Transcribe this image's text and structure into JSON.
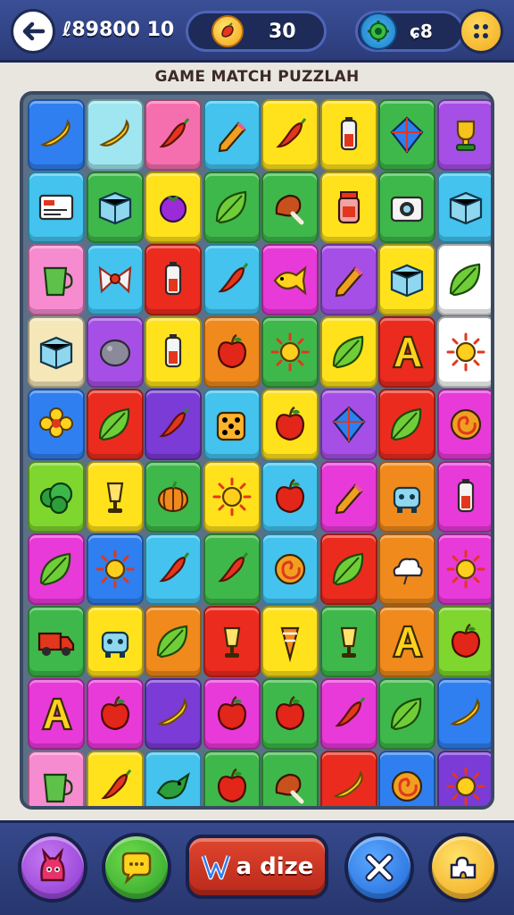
{
  "header": {
    "score_left": "ℓ89800 10",
    "center_count": "30",
    "right_label": "ɕ8",
    "icons": [
      "back-arrow-icon",
      "coin-icon",
      "gear-icon",
      "menu-dots-icon"
    ]
  },
  "title": "GAME MATCH PUZZLAH",
  "board": {
    "columns": 8,
    "rows": 10,
    "tiles": [
      {
        "color": "#2f7ff0",
        "icon": "banana"
      },
      {
        "color": "#9fe6f0",
        "icon": "banana"
      },
      {
        "color": "#f56fae",
        "icon": "chili"
      },
      {
        "color": "#43c3ee",
        "icon": "pencil"
      },
      {
        "color": "#ffe21c",
        "icon": "chili"
      },
      {
        "color": "#ffe21c",
        "icon": "battery"
      },
      {
        "color": "#3eb84a",
        "icon": "kite"
      },
      {
        "color": "#a64fe6",
        "icon": "trophy"
      },
      {
        "color": "#43c3ee",
        "icon": "card"
      },
      {
        "color": "#3eb84a",
        "icon": "box"
      },
      {
        "color": "#ffe21c",
        "icon": "berry"
      },
      {
        "color": "#3eb84a",
        "icon": "leaf"
      },
      {
        "color": "#3eb84a",
        "icon": "drumstick"
      },
      {
        "color": "#ffe21c",
        "icon": "jar"
      },
      {
        "color": "#3eb84a",
        "icon": "camera"
      },
      {
        "color": "#43c3ee",
        "icon": "box"
      },
      {
        "color": "#f78bd0",
        "icon": "cup"
      },
      {
        "color": "#43c3ee",
        "icon": "bow"
      },
      {
        "color": "#ec2b1f",
        "icon": "battery"
      },
      {
        "color": "#43c3ee",
        "icon": "chili"
      },
      {
        "color": "#e83ad8",
        "icon": "fish"
      },
      {
        "color": "#a64fe6",
        "icon": "pencil"
      },
      {
        "color": "#ffe21c",
        "icon": "box"
      },
      {
        "color": "#ffffff",
        "icon": "leaf"
      },
      {
        "color": "#f5e7b8",
        "icon": "box"
      },
      {
        "color": "#a64fe6",
        "icon": "stone"
      },
      {
        "color": "#ffe21c",
        "icon": "battery"
      },
      {
        "color": "#f08a1c",
        "icon": "apple"
      },
      {
        "color": "#3eb84a",
        "icon": "sun"
      },
      {
        "color": "#ffe21c",
        "icon": "leaf"
      },
      {
        "color": "#ec2b1f",
        "icon": "letter"
      },
      {
        "color": "#ffffff",
        "icon": "sun"
      },
      {
        "color": "#2f7ff0",
        "icon": "flower"
      },
      {
        "color": "#ec2b1f",
        "icon": "leaf"
      },
      {
        "color": "#7a3bd6",
        "icon": "chili"
      },
      {
        "color": "#43c3ee",
        "icon": "dice"
      },
      {
        "color": "#ffe21c",
        "icon": "apple"
      },
      {
        "color": "#a64fe6",
        "icon": "kite"
      },
      {
        "color": "#ec2b1f",
        "icon": "leaf"
      },
      {
        "color": "#e83ad8",
        "icon": "swirl"
      },
      {
        "color": "#7fd62e",
        "icon": "bush"
      },
      {
        "color": "#ffe21c",
        "icon": "lamp"
      },
      {
        "color": "#3eb84a",
        "icon": "pumpkin"
      },
      {
        "color": "#ffe21c",
        "icon": "sun"
      },
      {
        "color": "#43c3ee",
        "icon": "apple"
      },
      {
        "color": "#e83ad8",
        "icon": "pencil"
      },
      {
        "color": "#f08a1c",
        "icon": "robot"
      },
      {
        "color": "#e83ad8",
        "icon": "battery"
      },
      {
        "color": "#e83ad8",
        "icon": "leaf"
      },
      {
        "color": "#2f7ff0",
        "icon": "sun"
      },
      {
        "color": "#43c3ee",
        "icon": "chili"
      },
      {
        "color": "#3eb84a",
        "icon": "chili"
      },
      {
        "color": "#43c3ee",
        "icon": "swirl"
      },
      {
        "color": "#ec2b1f",
        "icon": "leaf"
      },
      {
        "color": "#f08a1c",
        "icon": "cloud"
      },
      {
        "color": "#e83ad8",
        "icon": "sun"
      },
      {
        "color": "#3eb84a",
        "icon": "truck"
      },
      {
        "color": "#ffe21c",
        "icon": "robot"
      },
      {
        "color": "#f08a1c",
        "icon": "leaf"
      },
      {
        "color": "#ec2b1f",
        "icon": "lamp"
      },
      {
        "color": "#ffe21c",
        "icon": "cone"
      },
      {
        "color": "#3eb84a",
        "icon": "lamp"
      },
      {
        "color": "#f08a1c",
        "icon": "letter"
      },
      {
        "color": "#7fd62e",
        "icon": "apple"
      },
      {
        "color": "#e83ad8",
        "icon": "letter"
      },
      {
        "color": "#e83ad8",
        "icon": "apple"
      },
      {
        "color": "#7a3bd6",
        "icon": "banana"
      },
      {
        "color": "#e83ad8",
        "icon": "apple"
      },
      {
        "color": "#3eb84a",
        "icon": "apple"
      },
      {
        "color": "#e83ad8",
        "icon": "chili"
      },
      {
        "color": "#3eb84a",
        "icon": "leaf"
      },
      {
        "color": "#2f7ff0",
        "icon": "banana"
      },
      {
        "color": "#f78bd0",
        "icon": "cup"
      },
      {
        "color": "#ffe21c",
        "icon": "chili"
      },
      {
        "color": "#43c3ee",
        "icon": "bird"
      },
      {
        "color": "#3eb84a",
        "icon": "apple"
      },
      {
        "color": "#3eb84a",
        "icon": "drumstick"
      },
      {
        "color": "#ec2b1f",
        "icon": "banana"
      },
      {
        "color": "#2f7ff0",
        "icon": "swirl"
      },
      {
        "color": "#7a3bd6",
        "icon": "sun"
      }
    ]
  },
  "footer": {
    "wide_button_label": "a dize",
    "buttons": [
      {
        "icon": "monster-icon",
        "color": "#a64fe6"
      },
      {
        "icon": "chat-icon",
        "color": "#3eb84a"
      },
      {
        "icon": "close-icon",
        "color": "#2f7ff0"
      },
      {
        "icon": "puzzle-icon",
        "color": "#f6c21c"
      }
    ]
  }
}
